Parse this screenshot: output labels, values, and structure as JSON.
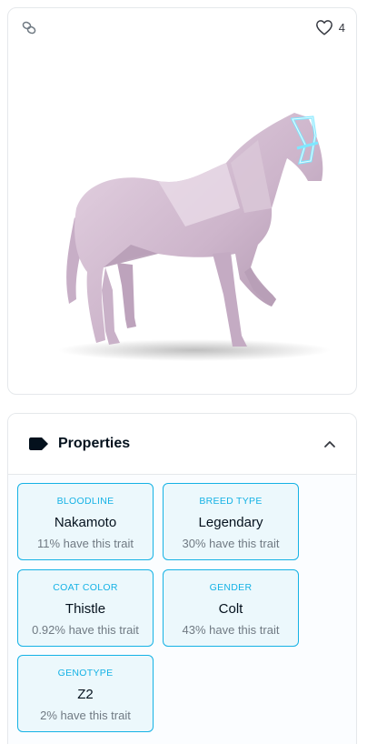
{
  "favorites": {
    "count": "4"
  },
  "properties": {
    "title": "Properties",
    "traits": [
      {
        "type": "BLOODLINE",
        "value": "Nakamoto",
        "rarity": "11% have this trait"
      },
      {
        "type": "BREED TYPE",
        "value": "Legendary",
        "rarity": "30% have this trait"
      },
      {
        "type": "COAT COLOR",
        "value": "Thistle",
        "rarity": "0.92% have this trait"
      },
      {
        "type": "GENDER",
        "value": "Colt",
        "rarity": "43% have this trait"
      },
      {
        "type": "GENOTYPE",
        "value": "Z2",
        "rarity": "2% have this trait"
      }
    ]
  },
  "colors": {
    "accent": "#15b2e5",
    "trait_bg": "#ecf8fc",
    "horse_coat": "#d8c3d6",
    "bridle_glow": "#7fe7ff"
  },
  "icons": {
    "chain": "chain-link-icon",
    "favorite": "heart-icon",
    "properties": "tag-icon",
    "collapse": "chevron-up-icon"
  }
}
